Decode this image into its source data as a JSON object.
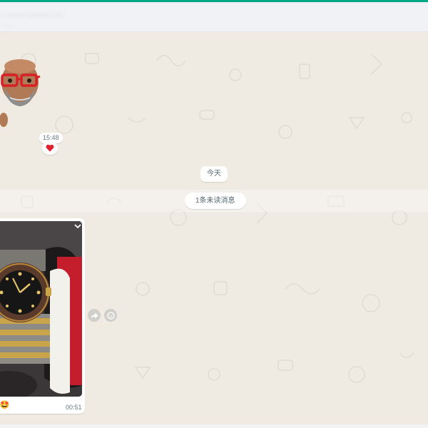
{
  "header": {
    "title": "· ······ ········ ···",
    "subtitle": "······"
  },
  "messages": {
    "sticker": {
      "icon": "memoji-sticker"
    },
    "sticker_time": "15:48",
    "sticker_reaction": "❤️",
    "date_divider": "今天",
    "unread_divider": "1条未读消息",
    "photo_message": {
      "image": "wristwatch-photo",
      "caption": "s! 🤩",
      "time": "00:51",
      "menu_icon": "chevron-down-icon"
    }
  },
  "hover_actions": {
    "forward_icon": "forward-icon",
    "react_icon": "emoji-react-icon"
  },
  "colors": {
    "accent": "#00a884",
    "chat_background": "#efeae2",
    "header_background": "#f0f2f5",
    "bubble": "#ffffff"
  }
}
